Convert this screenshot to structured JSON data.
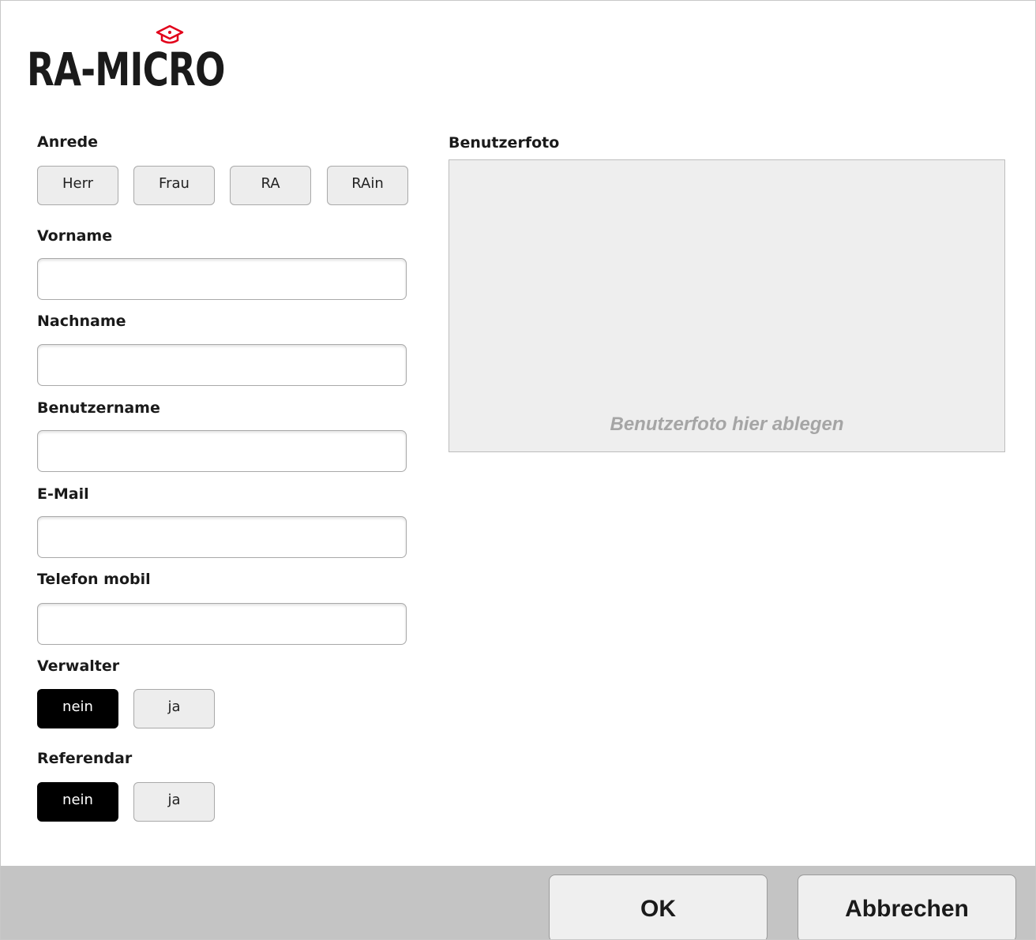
{
  "logo": {
    "text": "RA-MICRO",
    "accent_color": "#e2001a"
  },
  "form": {
    "anrede": {
      "label": "Anrede",
      "options": [
        "Herr",
        "Frau",
        "RA",
        "RAin"
      ]
    },
    "vorname": {
      "label": "Vorname",
      "value": ""
    },
    "nachname": {
      "label": "Nachname",
      "value": ""
    },
    "benutzername": {
      "label": "Benutzername",
      "value": ""
    },
    "email": {
      "label": "E-Mail",
      "value": ""
    },
    "telefon": {
      "label": "Telefon mobil",
      "value": ""
    },
    "verwalter": {
      "label": "Verwalter",
      "options": [
        "nein",
        "ja"
      ],
      "selected": "nein"
    },
    "referendar": {
      "label": "Referendar",
      "options": [
        "nein",
        "ja"
      ],
      "selected": "nein"
    }
  },
  "photo": {
    "label": "Benutzerfoto",
    "hint": "Benutzerfoto hier ablegen"
  },
  "footer": {
    "ok_label": "OK",
    "cancel_label": "Abbrechen"
  },
  "colors": {
    "selected_bg": "#000000",
    "footer_bg": "#c4c4c4",
    "photo_bg": "#eeeeee"
  }
}
